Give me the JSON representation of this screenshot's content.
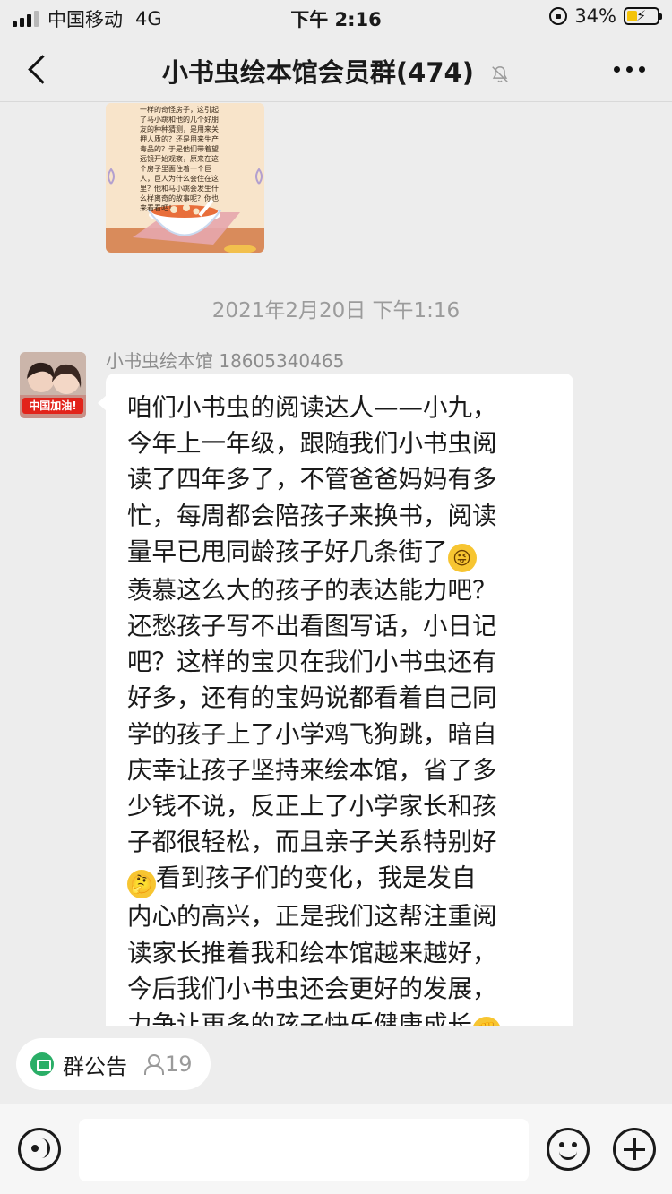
{
  "status_bar": {
    "carrier": "中国移动",
    "network": "4G",
    "time": "下午 2:16",
    "battery_percent": "34%",
    "battery_level": 0.34
  },
  "nav": {
    "title": "小书虫绘本馆会员群(474)",
    "muted": true
  },
  "chat": {
    "image_message": {
      "text_lines": [
        "一样的奇怪房子，这引起",
        "了马小跳和他的几个好朋",
        "友的种种猜测，是用来关",
        "押人质的？还是用来生产",
        "毒品的？于是他们带着望",
        "远镜开始观察，原来在这",
        "个房子里面住着一个巨",
        "人，巨人为什么会住在这",
        "里？他和马小跳会发生什",
        "么样离奇的故事呢？你也",
        "来看看吧！"
      ]
    },
    "timestamp": "2021年2月20日 下午1:16",
    "message": {
      "sender": "小书虫绘本馆 18605340465",
      "avatar_badge": "中国加油!",
      "lines": [
        "咱们小书虫的阅读达人——小九，",
        "今年上一年级，跟随我们小书虫阅",
        "读了四年多了，不管爸爸妈妈有多",
        "忙，每周都会陪孩子来换书，阅读",
        "量早已甩同龄孩子好几条街了",
        "羡慕这么大的孩子的表达能力吧？",
        "还愁孩子写不出看图写话，小日记",
        "吧？这样的宝贝在我们小书虫还有",
        "好多，还有的宝妈说都看着自己同",
        "学的孩子上了小学鸡飞狗跳，暗自",
        "庆幸让孩子坚持来绘本馆，省了多",
        "少钱不说，反正上了小学家长和孩",
        "子都很轻松，而且亲子关系特别好",
        "看到孩子们的变化，我是发自",
        "内心的高兴，正是我们这帮注重阅",
        "读家长推着我和绘本馆越来越好，",
        "今后我们小书虫还会更好的发展，",
        "力争让更多的孩子快乐健康成长"
      ],
      "emojis": {
        "wink": "😜",
        "thinking": "🤔",
        "fist": "✊"
      }
    }
  },
  "notice": {
    "label": "群公告",
    "count": "19"
  },
  "input": {
    "placeholder": ""
  }
}
